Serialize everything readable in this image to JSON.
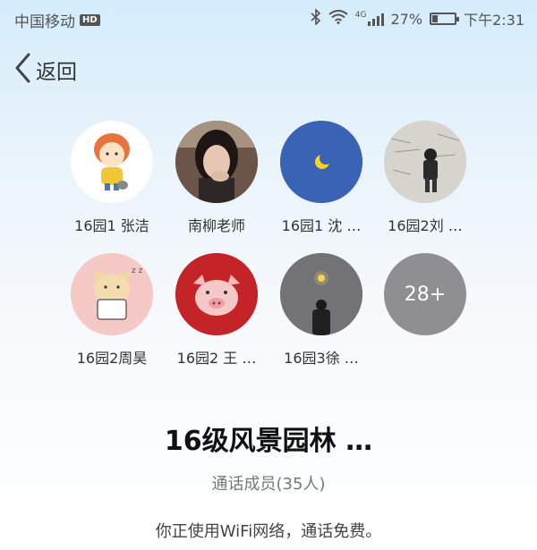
{
  "status_bar": {
    "carrier": "中国移动",
    "hd_badge": "HD",
    "network": "4G",
    "battery": "27%",
    "battery_level": 0.27,
    "time": "下午2:31"
  },
  "nav": {
    "back_label": "返回"
  },
  "members": [
    {
      "name": "16园1 张洁",
      "avatar_desc": "cartoon-girl-icon"
    },
    {
      "name": "南柳老师",
      "avatar_desc": "woman-photo"
    },
    {
      "name": "16园1 沈 …",
      "avatar_desc": "moon-icon"
    },
    {
      "name": "16园2刘 …",
      "avatar_desc": "person-wall-photo"
    },
    {
      "name": "16园2周昊",
      "avatar_desc": "bear-laptop-icon"
    },
    {
      "name": "16园2 王 …",
      "avatar_desc": "pig-cartoon-icon"
    },
    {
      "name": "16园3徐 …",
      "avatar_desc": "person-lightbulb-photo"
    }
  ],
  "more_members": "28+",
  "group": {
    "title": "16级风景园林 …",
    "subtitle": "通话成员(35人)"
  },
  "notice": "你正使用WiFi网络，通话免费。"
}
